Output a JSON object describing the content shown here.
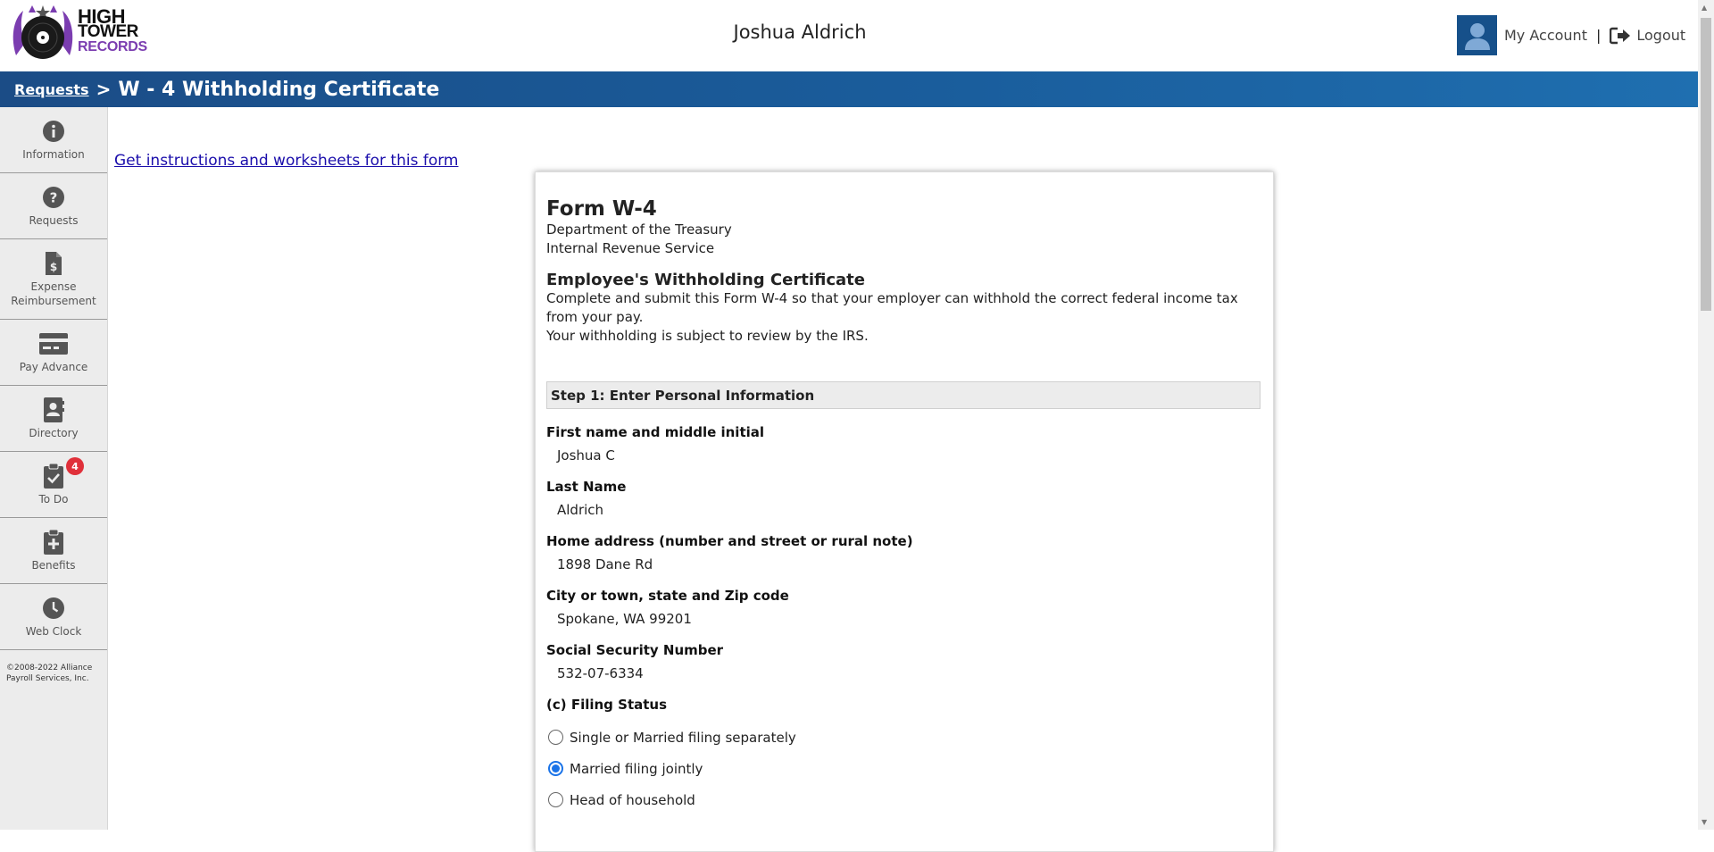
{
  "header": {
    "logo": {
      "line1": "HIGH",
      "line2": "TOWER",
      "line3": "RECORDS"
    },
    "user_name": "Joshua Aldrich",
    "my_account": "My Account",
    "separator": "|",
    "logout": "Logout"
  },
  "titlebar": {
    "breadcrumb_link": "Requests",
    "breadcrumb_sep": ">",
    "title": "W - 4 Withholding Certificate"
  },
  "sidebar": {
    "items": [
      {
        "label": "Information",
        "icon": "info-icon"
      },
      {
        "label": "Requests",
        "icon": "question-icon"
      },
      {
        "label": "Expense Reimbursement",
        "icon": "receipt-dollar-icon"
      },
      {
        "label": "Pay Advance",
        "icon": "credit-card-icon"
      },
      {
        "label": "Directory",
        "icon": "contact-book-icon"
      },
      {
        "label": "To Do",
        "icon": "clipboard-check-icon",
        "badge": "4"
      },
      {
        "label": "Benefits",
        "icon": "clipboard-plus-icon"
      },
      {
        "label": "Web Clock",
        "icon": "clock-icon"
      }
    ],
    "copyright": "©2008-2022 Alliance Payroll Services, Inc."
  },
  "main": {
    "instructions_link": "Get instructions and worksheets for this form"
  },
  "form": {
    "title": "Form W-4",
    "dept1": "Department of the Treasury",
    "dept2": "Internal Revenue Service",
    "cert_title": "Employee's Withholding Certificate",
    "desc1": "Complete and submit this Form W-4 so that your employer can withhold the correct federal income tax from your pay.",
    "desc2": "Your withholding is subject to review by the IRS.",
    "step1": "Step 1: Enter Personal Information",
    "fields": {
      "first_label": "First name and middle initial",
      "first_value": "Joshua C",
      "last_label": "Last Name",
      "last_value": "Aldrich",
      "address_label": "Home address (number and street or rural note)",
      "address_value": "1898 Dane Rd",
      "city_label": "City or town, state and Zip code",
      "city_value": "Spokane, WA 99201",
      "ssn_label": "Social Security Number",
      "ssn_value": "532-07-6334",
      "filing_label": "(c) Filing Status"
    },
    "filing_options": [
      {
        "label": "Single or Married filing separately",
        "selected": false
      },
      {
        "label": "Married filing jointly",
        "selected": true
      },
      {
        "label": "Head of household",
        "selected": false
      }
    ]
  },
  "colors": {
    "titlebar": "#1a5d9c",
    "avatar": "#16508a",
    "badge": "#e0303a",
    "radio_selected": "#1a73e8",
    "logo_accent": "#7b3db0"
  }
}
